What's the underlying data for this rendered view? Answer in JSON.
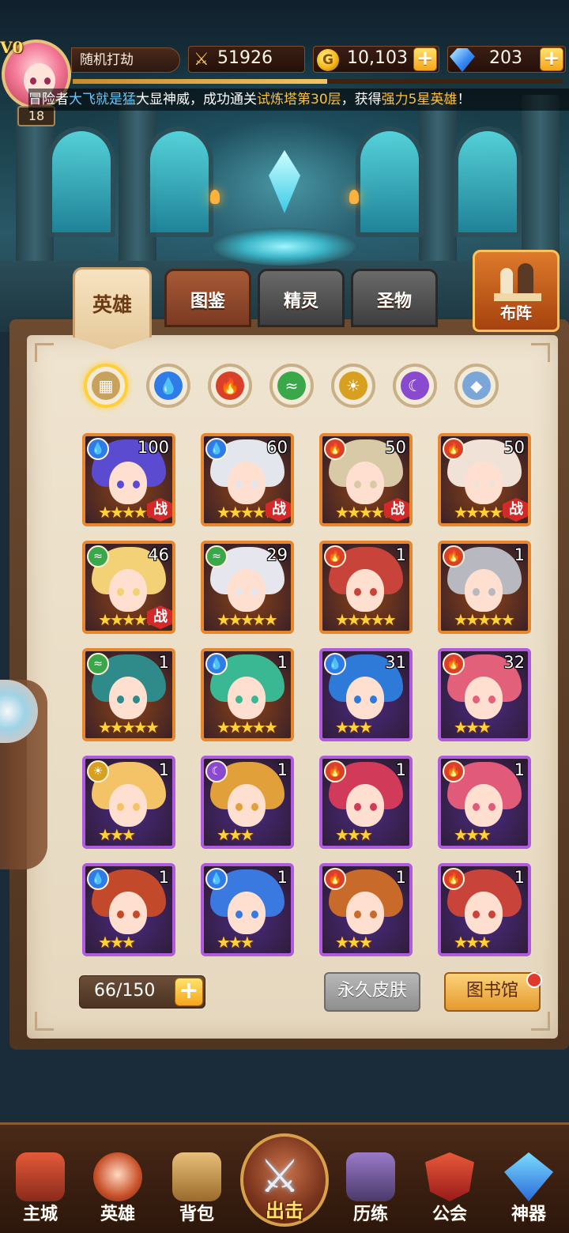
{
  "player": {
    "vip": "V0",
    "level": "18",
    "name": "随机打劫",
    "power": "51926",
    "gold": "10,103",
    "gems": "203"
  },
  "broadcast": {
    "p1": "冒险者",
    "name": "大飞就是猛",
    "p2": "大显神威，成功通关",
    "place": "试炼塔第30层",
    "p3": "，获得",
    "reward": "强力5星英雄",
    "p4": "！"
  },
  "tabs": {
    "hero": "英雄",
    "codex": "图鉴",
    "spirit": "精灵",
    "relic": "圣物",
    "formation": "布阵"
  },
  "filters": [
    "all",
    "water",
    "fire",
    "wind",
    "light",
    "dark",
    "neutral"
  ],
  "heroes": [
    {
      "element": "water",
      "level": "100",
      "stars": "★★★★★",
      "battle": "战",
      "frame": "gold",
      "hair": "#5a4bd0"
    },
    {
      "element": "water",
      "level": "60",
      "stars": "★★★★★",
      "battle": "战",
      "frame": "gold",
      "hair": "#e4e6ee"
    },
    {
      "element": "fire",
      "level": "50",
      "stars": "★★★★★",
      "battle": "战",
      "frame": "gold",
      "hair": "#d8caa6"
    },
    {
      "element": "fire",
      "level": "50",
      "stars": "★★★★★",
      "battle": "战",
      "frame": "gold",
      "hair": "#f1e2d8"
    },
    {
      "element": "wind",
      "level": "46",
      "stars": "★★★★★",
      "battle": "战",
      "frame": "gold",
      "hair": "#f3d277"
    },
    {
      "element": "wind",
      "level": "29",
      "stars": "★★★★★",
      "battle": "",
      "frame": "gold",
      "hair": "#e6e6ee"
    },
    {
      "element": "fire",
      "level": "1",
      "stars": "★★★★★",
      "battle": "",
      "frame": "gold",
      "hair": "#c8443a"
    },
    {
      "element": "fire",
      "level": "1",
      "stars": "★★★★★",
      "battle": "",
      "frame": "gold",
      "hair": "#b8b8c0"
    },
    {
      "element": "wind",
      "level": "1",
      "stars": "★★★★★",
      "battle": "",
      "frame": "gold",
      "hair": "#2f8a8a"
    },
    {
      "element": "water",
      "level": "1",
      "stars": "★★★★★",
      "battle": "",
      "frame": "gold",
      "hair": "#39b893"
    },
    {
      "element": "water",
      "level": "31",
      "stars": "★★★",
      "battle": "",
      "frame": "purple",
      "hair": "#2e7ad8"
    },
    {
      "element": "fire",
      "level": "32",
      "stars": "★★★",
      "battle": "",
      "frame": "purple",
      "hair": "#e2607a"
    },
    {
      "element": "light",
      "level": "1",
      "stars": "★★★",
      "battle": "",
      "frame": "purple",
      "hair": "#f4c368"
    },
    {
      "element": "dark",
      "level": "1",
      "stars": "★★★",
      "battle": "",
      "frame": "purple",
      "hair": "#e2a03a"
    },
    {
      "element": "fire",
      "level": "1",
      "stars": "★★★",
      "battle": "",
      "frame": "purple",
      "hair": "#d23a5a"
    },
    {
      "element": "fire",
      "level": "1",
      "stars": "★★★",
      "battle": "",
      "frame": "purple",
      "hair": "#e25a7a"
    },
    {
      "element": "water",
      "level": "1",
      "stars": "★★★",
      "battle": "",
      "frame": "purple",
      "hair": "#c24a2a"
    },
    {
      "element": "water",
      "level": "1",
      "stars": "★★★",
      "battle": "",
      "frame": "purple",
      "hair": "#3a7ae0"
    },
    {
      "element": "fire",
      "level": "1",
      "stars": "★★★",
      "battle": "",
      "frame": "purple",
      "hair": "#c86a2a"
    },
    {
      "element": "fire",
      "level": "1",
      "stars": "★★★",
      "battle": "",
      "frame": "purple",
      "hair": "#c8443a"
    }
  ],
  "capacity": "66/150",
  "buttons": {
    "skin": "永久皮肤",
    "library": "图书馆"
  },
  "nav": {
    "main_city": "主城",
    "heroes": "英雄",
    "bag": "背包",
    "attack": "出击",
    "trial": "历练",
    "guild": "公会",
    "artifact": "神器"
  },
  "colors": {
    "water": "#2f7be8",
    "fire": "#d8402a",
    "wind": "#3aa84a",
    "light": "#d8a020",
    "dark": "#8a4ad0",
    "neutral": "#7aa6d8",
    "frame_gold": "#e7862c",
    "frame_purple": "#b05ae0"
  }
}
